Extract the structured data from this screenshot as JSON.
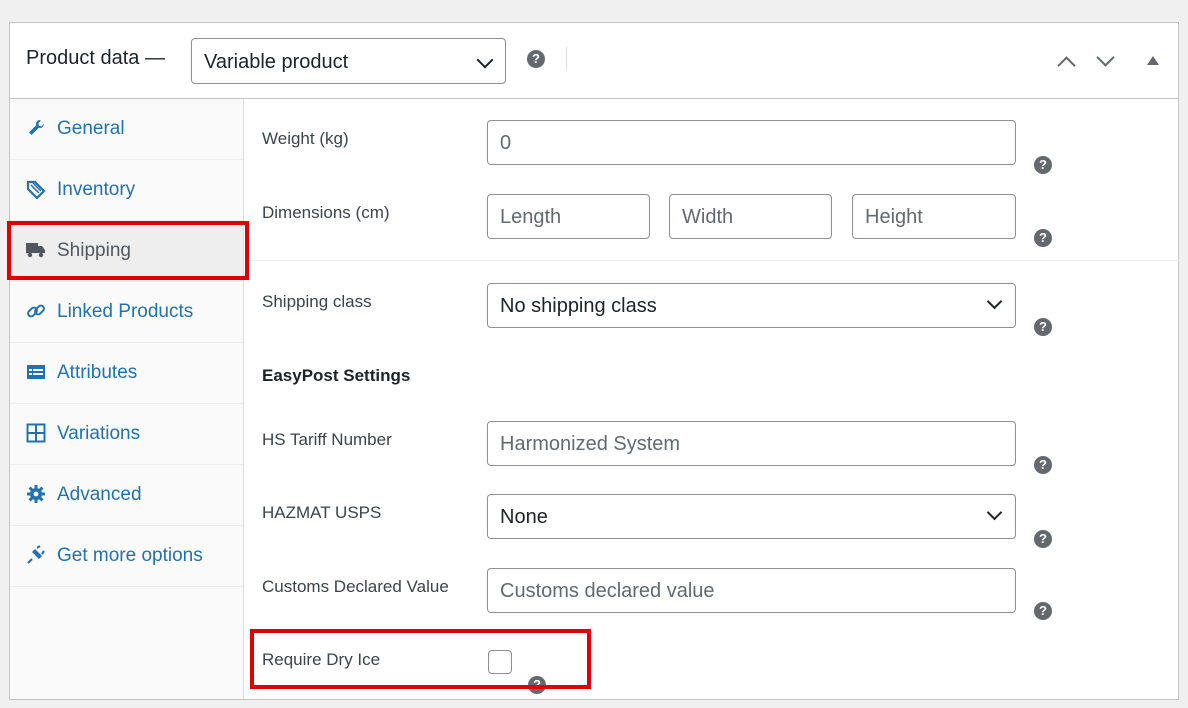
{
  "header": {
    "title": "Product data —",
    "product_type": "Variable product"
  },
  "tabs": [
    {
      "label": "General",
      "icon": "wrench-icon",
      "active": false
    },
    {
      "label": "Inventory",
      "icon": "tag-icon",
      "active": false
    },
    {
      "label": "Shipping",
      "icon": "truck-icon",
      "active": true
    },
    {
      "label": "Linked Products",
      "icon": "link-icon",
      "active": false
    },
    {
      "label": "Attributes",
      "icon": "list-table-icon",
      "active": false
    },
    {
      "label": "Variations",
      "icon": "grid-icon",
      "active": false
    },
    {
      "label": "Advanced",
      "icon": "gear-icon",
      "active": false
    },
    {
      "label": "Get more options",
      "icon": "plug-icon",
      "active": false
    }
  ],
  "shipping": {
    "weight_label": "Weight (kg)",
    "weight_placeholder": "0",
    "dimensions_label": "Dimensions (cm)",
    "length_placeholder": "Length",
    "width_placeholder": "Width",
    "height_placeholder": "Height",
    "shipping_class_label": "Shipping class",
    "shipping_class_value": "No shipping class"
  },
  "easypost": {
    "section_title": "EasyPost Settings",
    "hs_label": "HS Tariff Number",
    "hs_placeholder": "Harmonized System",
    "hazmat_label": "HAZMAT USPS",
    "hazmat_value": "None",
    "customs_label": "Customs Declared Value",
    "customs_placeholder": "Customs declared value",
    "dry_ice_label": "Require Dry Ice",
    "dry_ice_checked": false
  },
  "help_glyph": "?",
  "colors": {
    "link": "#2271b1",
    "highlight": "#e00000"
  }
}
